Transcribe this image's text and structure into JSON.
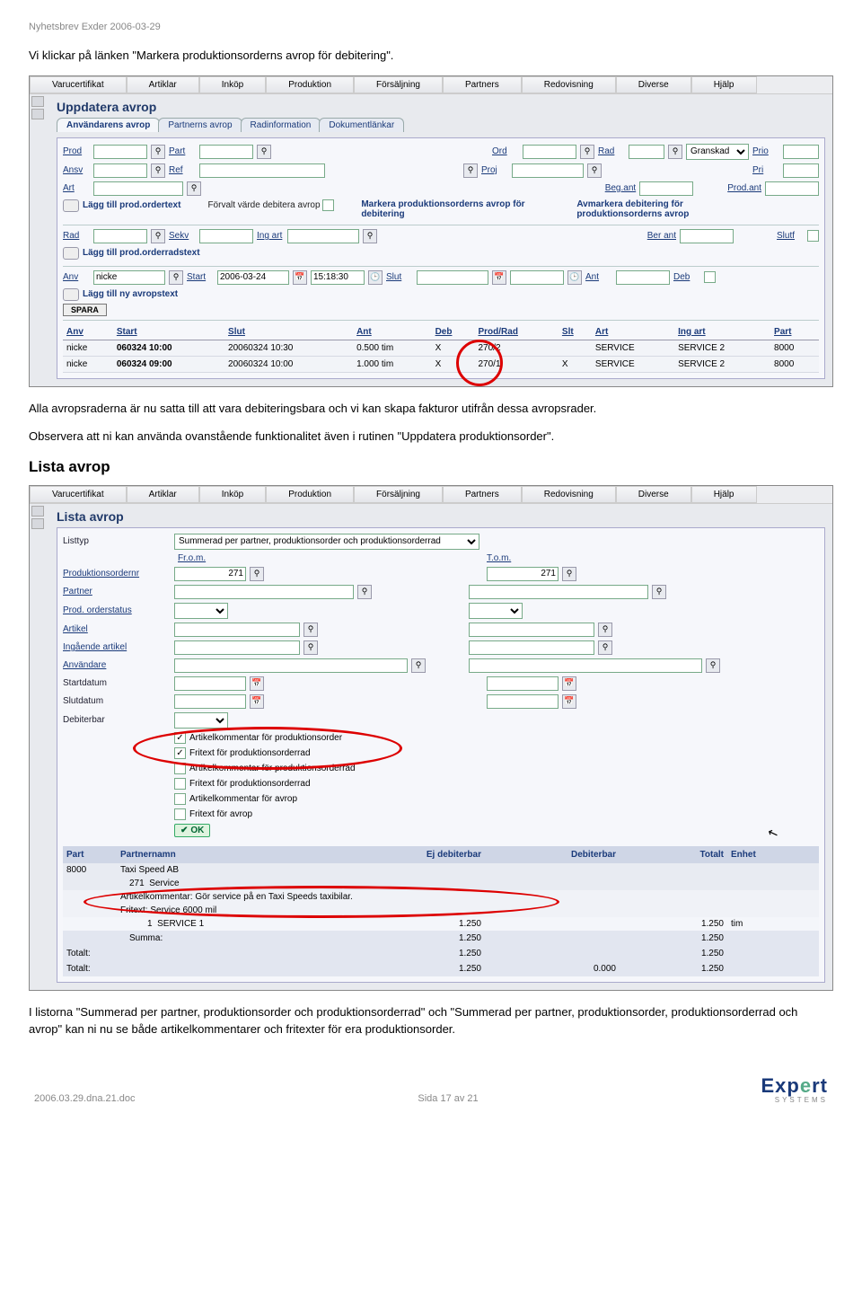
{
  "header_note": "Nyhetsbrev Exder 2006-03-29",
  "intro1": "Vi klickar på länken \"Markera produktionsorderns avrop för debitering\".",
  "intro2": "Alla avropsraderna är nu satta till att vara debiteringsbara och vi kan skapa fakturor utifrån dessa avropsrader.",
  "intro3": "Observera att ni kan använda ovanstående funktionalitet även i rutinen \"Uppdatera produktionsorder\".",
  "section2_title": "Lista avrop",
  "outro": "I listorna \"Summerad per partner, produktionsorder och produktionsorderrad\" och \"Summerad per partner, produktionsorder, produktionsorderrad och avrop\" kan ni nu se både artikelkommentarer och fritexter för era produktionsorder.",
  "footer": {
    "left": "2006.03.29.dna.21.doc",
    "center": "Sida 17 av 21"
  },
  "menu": [
    "Varucertifikat",
    "Artiklar",
    "Inköp",
    "Produktion",
    "Försäljning",
    "Partners",
    "Redovisning",
    "Diverse",
    "Hjälp"
  ],
  "screen1": {
    "title": "Uppdatera avrop",
    "tabs": [
      "Användarens avrop",
      "Partnerns avrop",
      "Radinformation",
      "Dokumentlänkar"
    ],
    "labels": {
      "prod": "Prod",
      "part": "Part",
      "ord": "Ord",
      "rad": "Rad",
      "granskad": "Granskad",
      "prio": "Prio",
      "ansv": "Ansv",
      "ref": "Ref",
      "proj": "Proj",
      "pri": "Pri",
      "art": "Art",
      "beg_ant": "Beg.ant",
      "prod_ant": "Prod.ant",
      "action_add_ordertext": "Lägg till prod.ordertext",
      "action_forvalt": "Förvalt värde debitera avrop",
      "action_markera": "Markera produktionsorderns avrop för debitering",
      "action_avmarkera": "Avmarkera debitering för produktionsorderns avrop",
      "rad2": "Rad",
      "sekv": "Sekv",
      "ing_art": "Ing art",
      "ber_ant": "Ber ant",
      "slutf": "Slutf",
      "action_add_radtext": "Lägg till prod.orderradstext",
      "anv": "Anv",
      "start": "Start",
      "slut": "Slut",
      "ant": "Ant",
      "deb": "Deb",
      "action_add_avropstext": "Lägg till ny avropstext",
      "spara": "SPARA"
    },
    "values": {
      "anv": "nicke",
      "start_date": "2006-03-24",
      "start_time": "15:18:30"
    },
    "table": {
      "headers": [
        "Anv",
        "Start",
        "Slut",
        "Ant",
        "Deb",
        "Prod/Rad",
        "Slt",
        "Art",
        "Ing art",
        "Part"
      ],
      "rows": [
        {
          "anv": "nicke",
          "start": "060324 10:00",
          "slut": "20060324 10:30",
          "ant": "0.500 tim",
          "deb": "X",
          "prodrad": "270/2",
          "slt": "",
          "art": "SERVICE",
          "ingart": "SERVICE 2",
          "part": "8000"
        },
        {
          "anv": "nicke",
          "start": "060324 09:00",
          "slut": "20060324 10:00",
          "ant": "1.000 tim",
          "deb": "X",
          "prodrad": "270/1",
          "slt": "X",
          "art": "SERVICE",
          "ingart": "SERVICE 2",
          "part": "8000"
        }
      ]
    }
  },
  "screen2": {
    "title": "Lista avrop",
    "labels": {
      "listtyp": "Listtyp",
      "from": "Fr.o.m.",
      "tom": "T.o.m.",
      "prodordernr": "Produktionsordernr",
      "partner": "Partner",
      "prodstatus": "Prod. orderstatus",
      "artikel": "Artikel",
      "ingartikel": "Ingående artikel",
      "anvandare": "Användare",
      "startdatum": "Startdatum",
      "slutdatum": "Slutdatum",
      "debiterbar": "Debiterbar",
      "ok": "OK"
    },
    "listtyp_value": "Summerad per partner, produktionsorder och produktionsorderrad",
    "prodnr_from": "271",
    "prodnr_to": "271",
    "checkboxes": [
      {
        "label": "Artikelkommentar för produktionsorder",
        "checked": true
      },
      {
        "label": "Fritext för produktionsorderrad",
        "checked": true
      },
      {
        "label": "Artikelkommentar för produktionsorderrad",
        "checked": false
      },
      {
        "label": "Fritext för produktionsorderrad",
        "checked": false
      },
      {
        "label": "Artikelkommentar för avrop",
        "checked": false
      },
      {
        "label": "Fritext för avrop",
        "checked": false
      }
    ],
    "results": {
      "headers": [
        "Part",
        "Partnernamn",
        "Ej debiterbar",
        "Debiterbar",
        "Totalt",
        "Enhet"
      ],
      "part": "8000",
      "partnernamn": "Taxi Speed AB",
      "order": "271",
      "order_name": "Service",
      "kommentar": "Artikelkommentar: Gör service på en Taxi Speeds taxibilar.",
      "fritext": "Fritext: Service 6000 mil",
      "line": {
        "nr": "1",
        "art": "SERVICE 1",
        "ejdeb": "1.250",
        "deb": "",
        "tot": "1.250",
        "enhet": "tim"
      },
      "summa_label": "Summa:",
      "summa_ejdeb": "1.250",
      "summa_tot": "1.250",
      "tot1_label": "Totalt:",
      "tot1_ejdeb": "1.250",
      "tot1_tot": "1.250",
      "tot2_label": "Totalt:",
      "tot2_ejdeb": "1.250",
      "tot2_deb": "0.000",
      "tot2_tot": "1.250"
    }
  }
}
